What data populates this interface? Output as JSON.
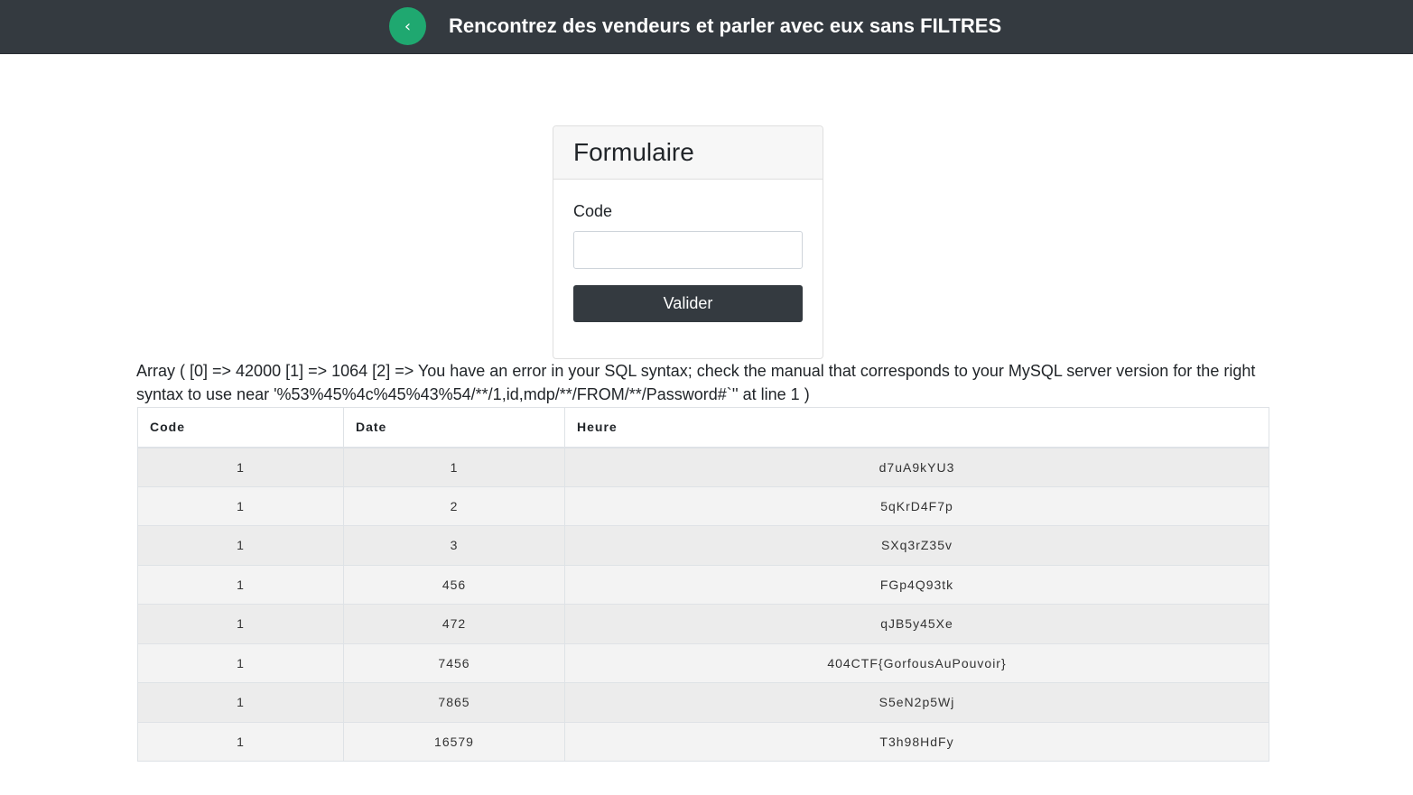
{
  "header": {
    "back_label": "‹",
    "title": "Rencontrez des vendeurs et parler avec eux sans FILTRES"
  },
  "form": {
    "title": "Formulaire",
    "code_label": "Code",
    "code_value": "",
    "submit_label": "Valider"
  },
  "error": {
    "message": "Array ( [0] => 42000 [1] => 1064 [2] => You have an error in your SQL syntax; check the manual that corresponds to your MySQL server version for the right syntax to use near '%53%45%4c%45%43%54/**/1,id,mdp/**/FROM/**/Password#`'' at line 1 )"
  },
  "table": {
    "headers": [
      "Code",
      "Date",
      "Heure"
    ],
    "rows": [
      [
        "1",
        "1",
        "d7uA9kYU3"
      ],
      [
        "1",
        "2",
        "5qKrD4F7p"
      ],
      [
        "1",
        "3",
        "SXq3rZ35v"
      ],
      [
        "1",
        "456",
        "FGp4Q93tk"
      ],
      [
        "1",
        "472",
        "qJB5y45Xe"
      ],
      [
        "1",
        "7456",
        "404CTF{GorfousAuPouvoir}"
      ],
      [
        "1",
        "7865",
        "S5eN2p5Wj"
      ],
      [
        "1",
        "16579",
        "T3h98HdFy"
      ]
    ]
  },
  "colors": {
    "topbar": "#343a40",
    "back_button": "#1fa870",
    "submit_button": "#343a40"
  }
}
